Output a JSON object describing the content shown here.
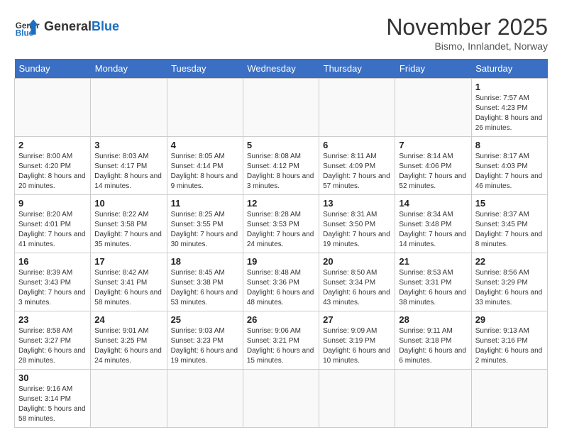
{
  "header": {
    "logo_general": "General",
    "logo_blue": "Blue",
    "title": "November 2025",
    "subtitle": "Bismo, Innlandet, Norway"
  },
  "days_of_week": [
    "Sunday",
    "Monday",
    "Tuesday",
    "Wednesday",
    "Thursday",
    "Friday",
    "Saturday"
  ],
  "weeks": [
    {
      "cells": [
        {
          "day": "",
          "info": ""
        },
        {
          "day": "",
          "info": ""
        },
        {
          "day": "",
          "info": ""
        },
        {
          "day": "",
          "info": ""
        },
        {
          "day": "",
          "info": ""
        },
        {
          "day": "",
          "info": ""
        },
        {
          "day": "1",
          "info": "Sunrise: 7:57 AM\nSunset: 4:23 PM\nDaylight: 8 hours\nand 26 minutes."
        }
      ]
    },
    {
      "cells": [
        {
          "day": "2",
          "info": "Sunrise: 8:00 AM\nSunset: 4:20 PM\nDaylight: 8 hours\nand 20 minutes."
        },
        {
          "day": "3",
          "info": "Sunrise: 8:03 AM\nSunset: 4:17 PM\nDaylight: 8 hours\nand 14 minutes."
        },
        {
          "day": "4",
          "info": "Sunrise: 8:05 AM\nSunset: 4:14 PM\nDaylight: 8 hours\nand 9 minutes."
        },
        {
          "day": "5",
          "info": "Sunrise: 8:08 AM\nSunset: 4:12 PM\nDaylight: 8 hours\nand 3 minutes."
        },
        {
          "day": "6",
          "info": "Sunrise: 8:11 AM\nSunset: 4:09 PM\nDaylight: 7 hours\nand 57 minutes."
        },
        {
          "day": "7",
          "info": "Sunrise: 8:14 AM\nSunset: 4:06 PM\nDaylight: 7 hours\nand 52 minutes."
        },
        {
          "day": "8",
          "info": "Sunrise: 8:17 AM\nSunset: 4:03 PM\nDaylight: 7 hours\nand 46 minutes."
        }
      ]
    },
    {
      "cells": [
        {
          "day": "9",
          "info": "Sunrise: 8:20 AM\nSunset: 4:01 PM\nDaylight: 7 hours\nand 41 minutes."
        },
        {
          "day": "10",
          "info": "Sunrise: 8:22 AM\nSunset: 3:58 PM\nDaylight: 7 hours\nand 35 minutes."
        },
        {
          "day": "11",
          "info": "Sunrise: 8:25 AM\nSunset: 3:55 PM\nDaylight: 7 hours\nand 30 minutes."
        },
        {
          "day": "12",
          "info": "Sunrise: 8:28 AM\nSunset: 3:53 PM\nDaylight: 7 hours\nand 24 minutes."
        },
        {
          "day": "13",
          "info": "Sunrise: 8:31 AM\nSunset: 3:50 PM\nDaylight: 7 hours\nand 19 minutes."
        },
        {
          "day": "14",
          "info": "Sunrise: 8:34 AM\nSunset: 3:48 PM\nDaylight: 7 hours\nand 14 minutes."
        },
        {
          "day": "15",
          "info": "Sunrise: 8:37 AM\nSunset: 3:45 PM\nDaylight: 7 hours\nand 8 minutes."
        }
      ]
    },
    {
      "cells": [
        {
          "day": "16",
          "info": "Sunrise: 8:39 AM\nSunset: 3:43 PM\nDaylight: 7 hours\nand 3 minutes."
        },
        {
          "day": "17",
          "info": "Sunrise: 8:42 AM\nSunset: 3:41 PM\nDaylight: 6 hours\nand 58 minutes."
        },
        {
          "day": "18",
          "info": "Sunrise: 8:45 AM\nSunset: 3:38 PM\nDaylight: 6 hours\nand 53 minutes."
        },
        {
          "day": "19",
          "info": "Sunrise: 8:48 AM\nSunset: 3:36 PM\nDaylight: 6 hours\nand 48 minutes."
        },
        {
          "day": "20",
          "info": "Sunrise: 8:50 AM\nSunset: 3:34 PM\nDaylight: 6 hours\nand 43 minutes."
        },
        {
          "day": "21",
          "info": "Sunrise: 8:53 AM\nSunset: 3:31 PM\nDaylight: 6 hours\nand 38 minutes."
        },
        {
          "day": "22",
          "info": "Sunrise: 8:56 AM\nSunset: 3:29 PM\nDaylight: 6 hours\nand 33 minutes."
        }
      ]
    },
    {
      "cells": [
        {
          "day": "23",
          "info": "Sunrise: 8:58 AM\nSunset: 3:27 PM\nDaylight: 6 hours\nand 28 minutes."
        },
        {
          "day": "24",
          "info": "Sunrise: 9:01 AM\nSunset: 3:25 PM\nDaylight: 6 hours\nand 24 minutes."
        },
        {
          "day": "25",
          "info": "Sunrise: 9:03 AM\nSunset: 3:23 PM\nDaylight: 6 hours\nand 19 minutes."
        },
        {
          "day": "26",
          "info": "Sunrise: 9:06 AM\nSunset: 3:21 PM\nDaylight: 6 hours\nand 15 minutes."
        },
        {
          "day": "27",
          "info": "Sunrise: 9:09 AM\nSunset: 3:19 PM\nDaylight: 6 hours\nand 10 minutes."
        },
        {
          "day": "28",
          "info": "Sunrise: 9:11 AM\nSunset: 3:18 PM\nDaylight: 6 hours\nand 6 minutes."
        },
        {
          "day": "29",
          "info": "Sunrise: 9:13 AM\nSunset: 3:16 PM\nDaylight: 6 hours\nand 2 minutes."
        }
      ]
    },
    {
      "cells": [
        {
          "day": "30",
          "info": "Sunrise: 9:16 AM\nSunset: 3:14 PM\nDaylight: 5 hours\nand 58 minutes."
        },
        {
          "day": "",
          "info": ""
        },
        {
          "day": "",
          "info": ""
        },
        {
          "day": "",
          "info": ""
        },
        {
          "day": "",
          "info": ""
        },
        {
          "day": "",
          "info": ""
        },
        {
          "day": "",
          "info": ""
        }
      ]
    }
  ]
}
